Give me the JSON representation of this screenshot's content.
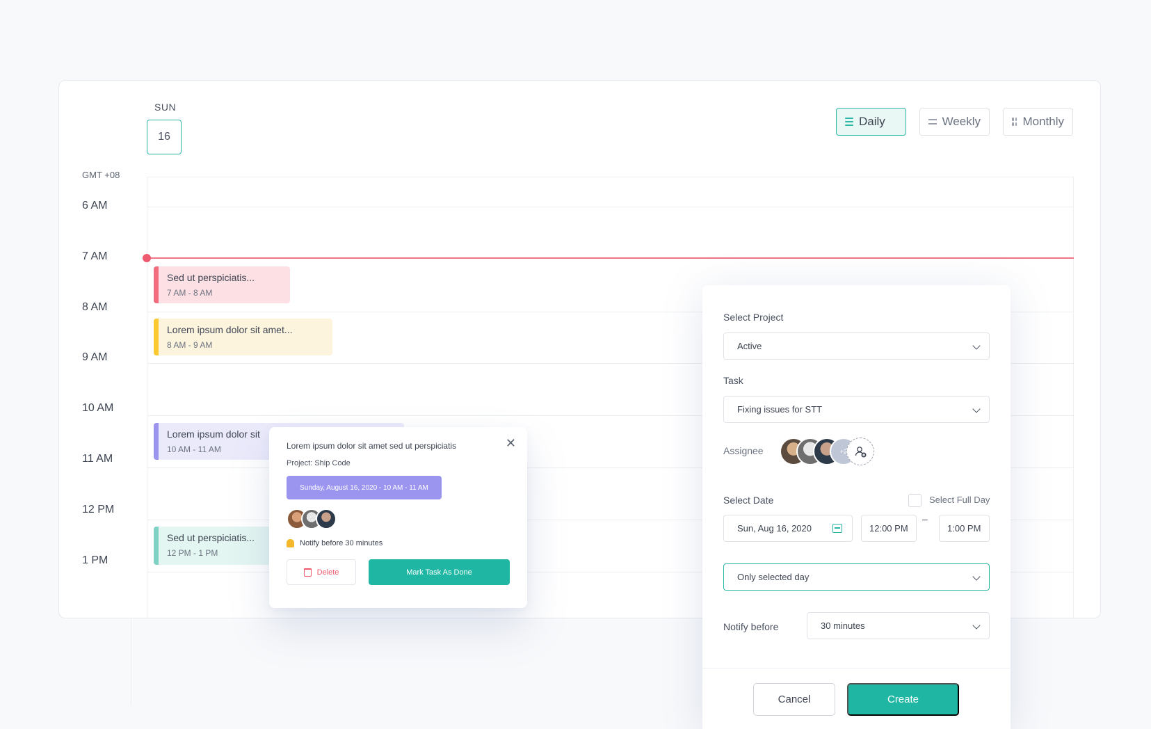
{
  "calendar": {
    "day_label": "SUN",
    "day_number": "16",
    "timezone": "GMT +08",
    "hours": [
      "6 AM",
      "7 AM",
      "8 AM",
      "9 AM",
      "10 AM",
      "11 AM",
      "12 PM",
      "1 PM"
    ]
  },
  "views": {
    "daily": "Daily",
    "weekly": "Weekly",
    "monthly": "Monthly",
    "active": "Daily"
  },
  "events": [
    {
      "title": "Sed ut perspiciatis...",
      "time": "7 AM - 8 AM",
      "color": "#f06c7e"
    },
    {
      "title": "Lorem ipsum dolor sit amet...",
      "time": "8 AM - 9 AM",
      "color": "#fbc930"
    },
    {
      "title": "Lorem ipsum dolor sit",
      "time": "10 AM - 11 AM",
      "color": "#9b94ef"
    },
    {
      "title": "Sed ut perspiciatis...",
      "time": "12 PM - 1 PM",
      "color": "#7fd1c4"
    }
  ],
  "popover": {
    "title": "Lorem ipsum dolor sit amet sed ut perspiciatis",
    "project": "Project: Ship Code",
    "date_range": "Sunday, August 16, 2020 - 10 AM - 11 AM",
    "notify": "Notify before 30 minutes",
    "delete_label": "Delete",
    "done_label": "Mark Task As Done"
  },
  "form": {
    "project_label": "Select Project",
    "project_value": "Active",
    "task_label": "Task",
    "task_value": "Fixing issues for STT",
    "assignee_label": "Assignee",
    "assignee_more": "+2",
    "date_label": "Select Date",
    "full_day_label": "Select Full Day",
    "date_value": "Sun, Aug 16, 2020",
    "start_time": "12:00 PM",
    "time_separator": "–",
    "end_time": "1:00 PM",
    "repeat_value": "Only selected day",
    "notify_label": "Notify before",
    "notify_value": "30 minutes",
    "cancel_label": "Cancel",
    "create_label": "Create"
  },
  "colors": {
    "accent": "#1fb7a3",
    "now_line": "#f07583",
    "delete": "#ef5a6f"
  }
}
